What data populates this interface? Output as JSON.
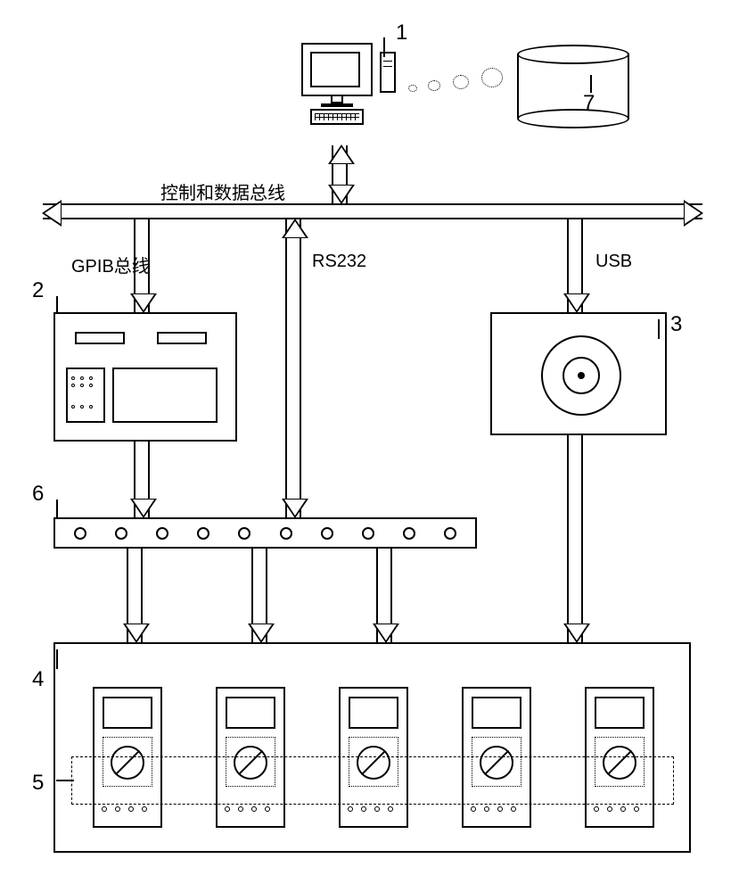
{
  "labels": {
    "computer": "1",
    "device2": "2",
    "device3": "3",
    "device4": "4",
    "device5": "5",
    "device6": "6",
    "database": "7"
  },
  "bus": {
    "main": "控制和数据总线",
    "gpib": "GPIB总线",
    "rs232": "RS232",
    "usb": "USB"
  }
}
